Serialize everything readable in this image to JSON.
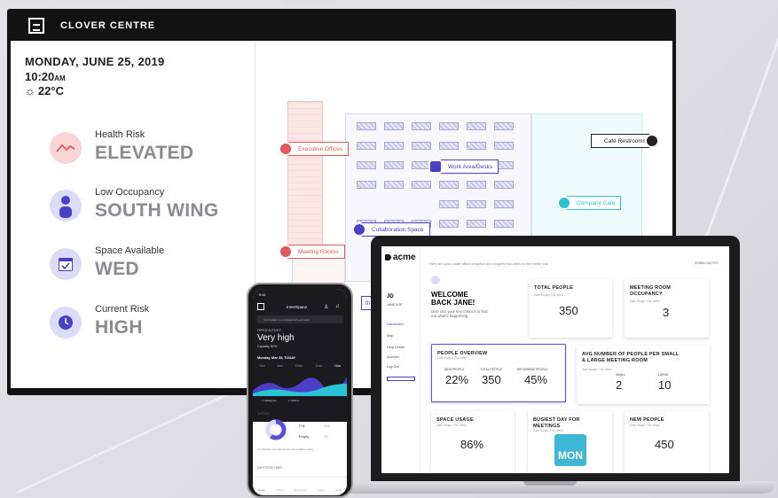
{
  "tv": {
    "title": "CLOVER CENTRE",
    "date": "MONDAY, JUNE 25, 2019",
    "time": "10:20",
    "time_suffix": "AM",
    "temperature": "22°C",
    "stats": [
      {
        "label": "Health Risk",
        "value": "ELEVATED",
        "icon": "trend-line-icon",
        "color": "#f8d4d4"
      },
      {
        "label": "Low Occupancy",
        "value": "SOUTH WING",
        "icon": "person-icon",
        "color": "#dcdcf8"
      },
      {
        "label": "Space Available",
        "value": "WED",
        "icon": "calendar-check-icon",
        "color": "#dcdcf8"
      },
      {
        "label": "Current Risk",
        "value": "HIGH",
        "icon": "clock-icon",
        "color": "#dcdcf8"
      }
    ],
    "map_labels": {
      "executive": "Executive Offices",
      "work": "Work Area/Desks",
      "cafe_rest": "Café Restrooms",
      "company_cafe": "Company Cafe",
      "collab": "Collaboration Space",
      "meeting": "Meeting Rooms",
      "partial": "th Wi"
    }
  },
  "laptop": {
    "brand": "acme",
    "header_line": "Here are your smart office analytics and insights this week for the entire site.",
    "download": "DOWNLOAD PDF",
    "initials": "JD",
    "user_name": "JANE DOE",
    "nav": [
      "Dashboard",
      "Map",
      "Help Center",
      "Account",
      "Log Out"
    ],
    "welcome": "WELCOME BACK JANE!",
    "welcome_sub": "Dive into your key metrics to find out what's happening.",
    "cards": {
      "total_people": {
        "title": "TOTAL PEOPLE",
        "sub": "Date Range: This Week",
        "value": "350"
      },
      "meeting_occ": {
        "title": "MEETING ROOM OCCUPANCY",
        "sub": "Date Range: This Week",
        "value": "3"
      },
      "overview": {
        "title": "PEOPLE OVERVIEW",
        "sub": "Date Range: This Week",
        "cols": [
          {
            "label": "NEW PEOPLE",
            "value": "22%"
          },
          {
            "label": "TOTAL PEOPLE",
            "value": "350"
          },
          {
            "label": "RETURNING PEOPLE",
            "value": "45%"
          }
        ]
      },
      "avg": {
        "title": "AVG NUMBER OF PEOPLE PER SMALL & LARGE MEETING ROOM",
        "sub": "Date Range: This Week",
        "small_label": "SMALL",
        "small": "2",
        "large_label": "LARGE",
        "large": "10"
      },
      "space": {
        "title": "SPACE USAGE",
        "sub": "Date Range: This Week",
        "value": "86%"
      },
      "busiest": {
        "title": "BUSIEST DAY FOR MEETINGS",
        "sub": "Date Range: This Week",
        "value": "MON"
      },
      "new_people": {
        "title": "NEW PEOPLE",
        "sub": "Date Range: This Week",
        "value": "450"
      }
    }
  },
  "phone": {
    "status_time": "9:41",
    "app_title": "InnerSpace",
    "search_placeholder": "Your location is not shared with your team",
    "activity_label": "OFFICE ACTIVITY",
    "activity_value": "Very high",
    "capacity": "Capacity 82%",
    "date": "Monday, Mar 25, TODAY",
    "hours": [
      "7am",
      "9am",
      "10am",
      "11am",
      "Now"
    ],
    "legend": [
      "Colleagues",
      "Visitors"
    ],
    "seating_label": "SEATING",
    "seating_progress": 0.6,
    "seating_rows": [
      {
        "label": "Full",
        "value": "156"
      },
      {
        "label": "Empty",
        "value": "23"
      }
    ],
    "tip": "Tip: 3rd Floor, west side has the most available seating",
    "cafeteria": "CAFETERIA TIMES",
    "tabs": [
      "Home",
      "Offices",
      "Resources",
      "Lanes",
      "Tools"
    ]
  }
}
